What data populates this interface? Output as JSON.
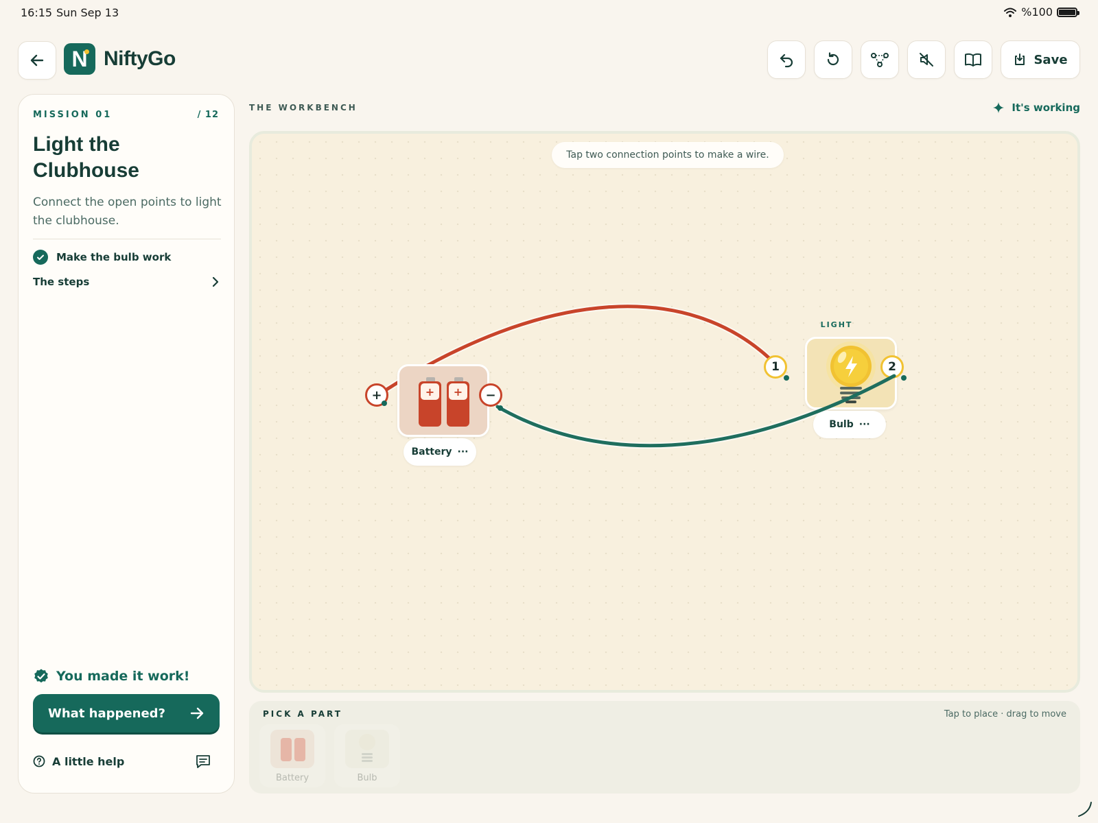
{
  "status_bar": {
    "time": "16:15",
    "date": "Sun Sep 13",
    "battery": "%100"
  },
  "header": {
    "app_name": "NiftyGo",
    "logo_letter": "N",
    "toolbar": [
      "undo-icon",
      "restart-icon",
      "circuit-view-icon",
      "sound-off-icon",
      "guide-book-icon"
    ],
    "save_label": "Save"
  },
  "mission": {
    "label": "MISSION 01",
    "count": "/ 12",
    "title": "Light the Clubhouse",
    "description": "Connect the open points to light the clubhouse.",
    "goal": {
      "text": "Make the bulb work",
      "done": true
    },
    "steps_label": "The steps",
    "success_text": "You made it work!",
    "cta_label": "What happened?",
    "help_label": "A little help"
  },
  "workbench": {
    "label": "THE WORKBENCH",
    "status": "It's working",
    "hint": "Tap two connection points to make a wire.",
    "battery": {
      "name": "Battery",
      "plus": "+",
      "minus": "−",
      "cell_symbol": "+"
    },
    "bulb": {
      "tag": "LIGHT",
      "name": "Bulb",
      "terminal_1": "1",
      "terminal_2": "2"
    },
    "more_glyph": "···",
    "colors": {
      "positive_wire": "#c8442a",
      "negative_wire": "#1f6e5e",
      "accent": "#16695b"
    }
  },
  "tray": {
    "label": "PICK A PART",
    "hint": "Tap to place · drag to move",
    "items": [
      {
        "name": "Battery"
      },
      {
        "name": "Bulb"
      }
    ]
  }
}
